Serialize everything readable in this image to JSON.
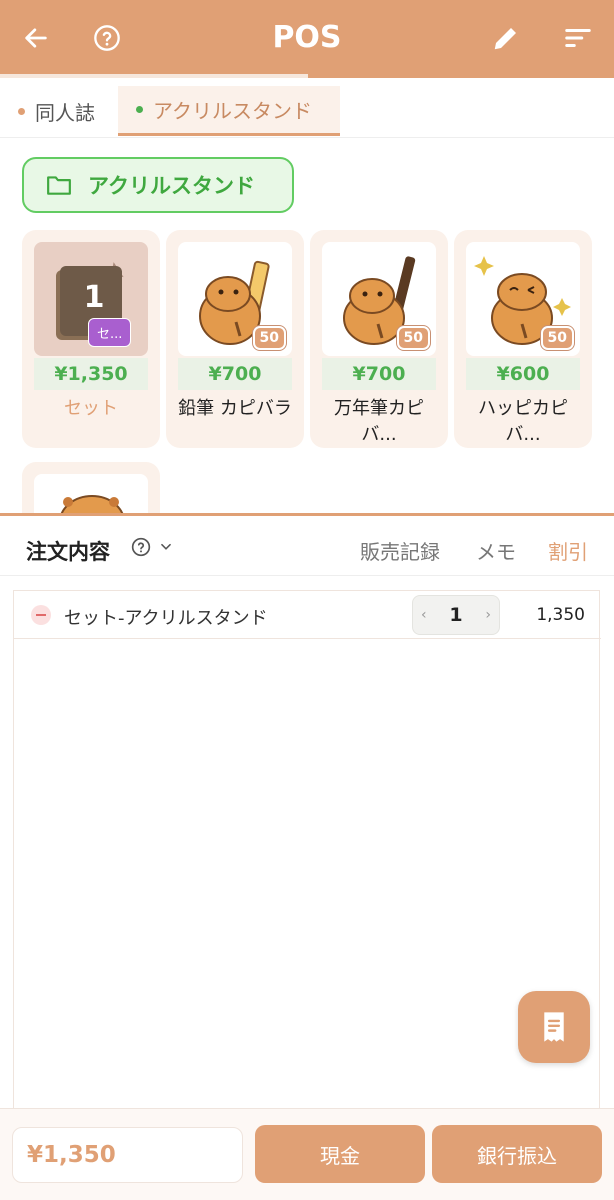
{
  "header": {
    "title": "POS",
    "back_icon": "arrow-left-icon",
    "help_icon": "help-circle-icon",
    "edit_icon": "pencil-icon",
    "sort_icon": "sort-icon",
    "color": "#e0a075"
  },
  "tabs": [
    {
      "label": "同人誌",
      "dot_color": "#e0a075",
      "active": false
    },
    {
      "label": "アクリルスタンド",
      "dot_color": "#4caf50",
      "active": true
    }
  ],
  "folder": {
    "label": "アクリルスタンド",
    "icon": "folder-icon"
  },
  "products": [
    {
      "price": "¥1,350",
      "name": "セット",
      "set_count": "1",
      "set_tag": "セ..."
    },
    {
      "price": "¥700",
      "name": "鉛筆 カピバラ",
      "stock": "50"
    },
    {
      "price": "¥700",
      "name": "万年筆カピバ...",
      "stock": "50"
    },
    {
      "price": "¥600",
      "name": "ハッピカピバ...",
      "stock": "50"
    }
  ],
  "order": {
    "title": "注文内容",
    "tabs": [
      "販売記録",
      "メモ",
      "割引"
    ],
    "items": [
      {
        "name": "セット-アクリルスタンド",
        "qty": "1",
        "total": "1,350"
      }
    ]
  },
  "footer": {
    "total": "¥1,350",
    "cash_label": "現金",
    "bank_label": "銀行振込"
  }
}
